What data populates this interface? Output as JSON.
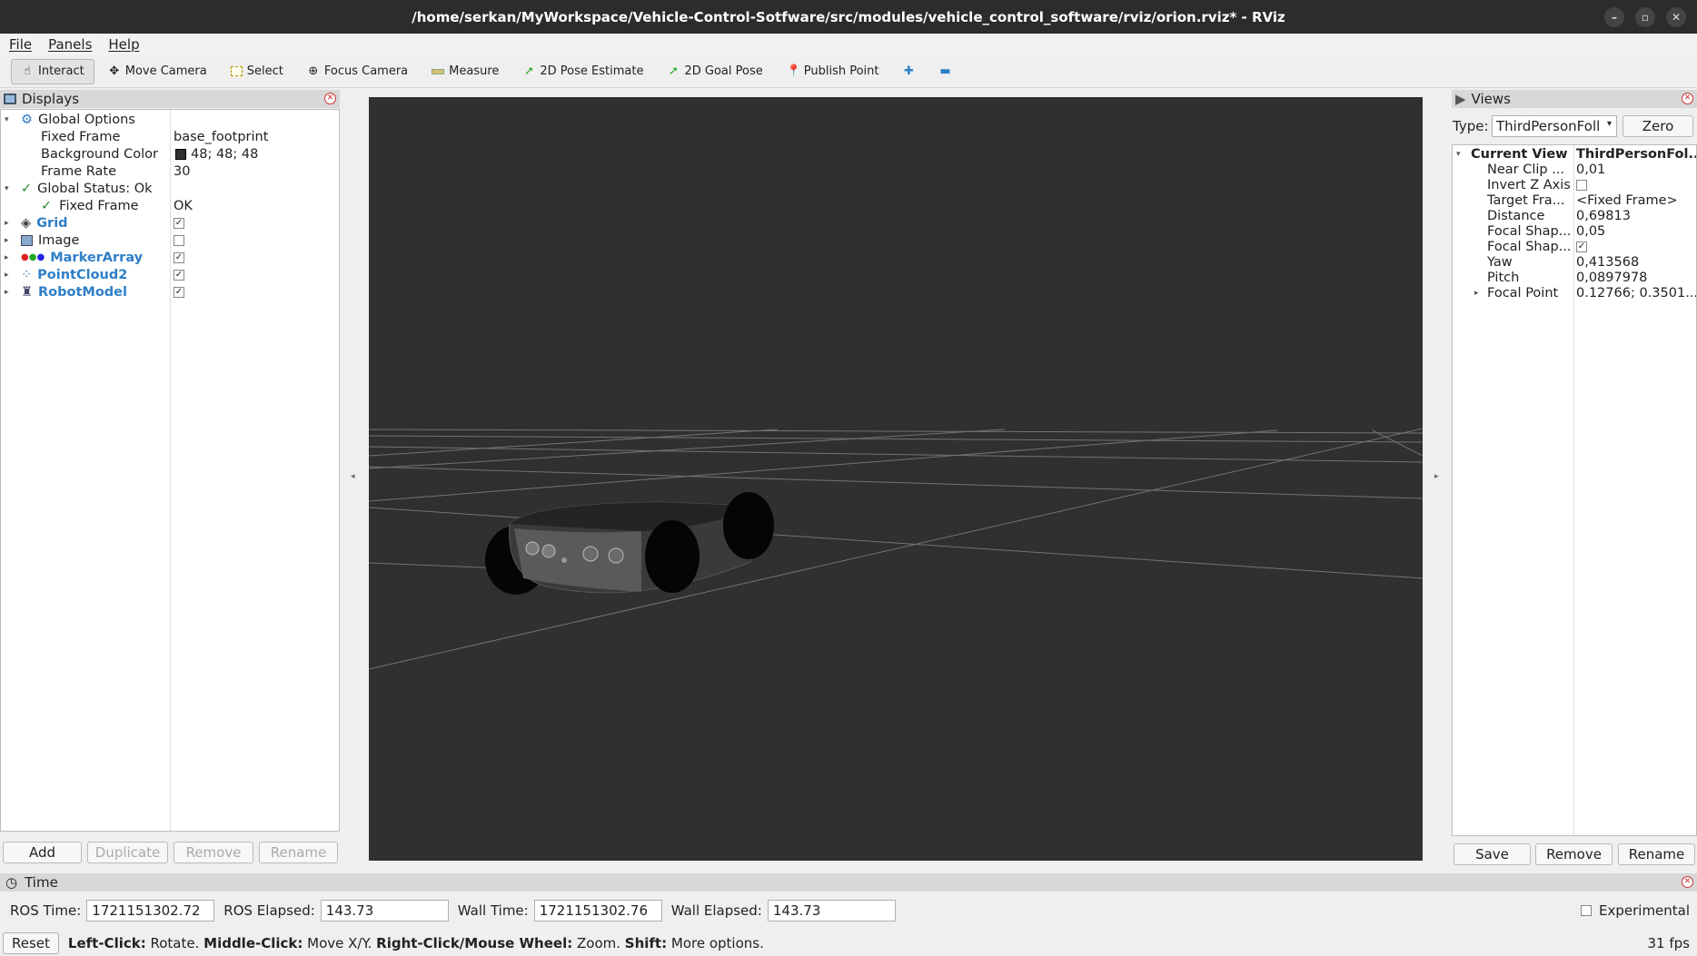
{
  "window": {
    "title": "/home/serkan/MyWorkspace/Vehicle-Control-Sotfware/src/modules/vehicle_control_software/rviz/orion.rviz* - RViz"
  },
  "menu": {
    "file": "File",
    "panels": "Panels",
    "help": "Help"
  },
  "toolbar": {
    "interact": "Interact",
    "move_camera": "Move Camera",
    "select": "Select",
    "focus_camera": "Focus Camera",
    "measure": "Measure",
    "pose_estimate": "2D Pose Estimate",
    "goal_pose": "2D Goal Pose",
    "publish_point": "Publish Point"
  },
  "displays": {
    "title": "Displays",
    "global_options": "Global Options",
    "fixed_frame_label": "Fixed Frame",
    "fixed_frame_value": "base_footprint",
    "bg_color_label": "Background Color",
    "bg_color_value": "48; 48; 48",
    "frame_rate_label": "Frame Rate",
    "frame_rate_value": "30",
    "global_status": "Global Status: Ok",
    "status_fixed_frame_label": "Fixed Frame",
    "status_fixed_frame_value": "OK",
    "items": [
      {
        "label": "Grid",
        "checked": true
      },
      {
        "label": "Image",
        "checked": false
      },
      {
        "label": "MarkerArray",
        "checked": true
      },
      {
        "label": "PointCloud2",
        "checked": true
      },
      {
        "label": "RobotModel",
        "checked": true
      }
    ],
    "buttons": {
      "add": "Add",
      "duplicate": "Duplicate",
      "remove": "Remove",
      "rename": "Rename"
    }
  },
  "views": {
    "title": "Views",
    "type_label": "Type:",
    "type_value": "ThirdPersonFoll",
    "zero": "Zero",
    "current_view": "Current View",
    "current_view_value": "ThirdPersonFol...",
    "props": [
      {
        "label": "Near Clip ...",
        "value": "0,01"
      },
      {
        "label": "Invert Z Axis",
        "value": ""
      },
      {
        "label": "Target Fra...",
        "value": "<Fixed Frame>"
      },
      {
        "label": "Distance",
        "value": "0,69813"
      },
      {
        "label": "Focal Shap...",
        "value": "0,05"
      },
      {
        "label": "Focal Shap...",
        "value": ""
      },
      {
        "label": "Yaw",
        "value": "0,413568"
      },
      {
        "label": "Pitch",
        "value": "0,0897978"
      },
      {
        "label": "Focal Point",
        "value": "0.12766; 0.3501..."
      }
    ],
    "buttons": {
      "save": "Save",
      "remove": "Remove",
      "rename": "Rename"
    }
  },
  "time": {
    "title": "Time",
    "ros_time_label": "ROS Time:",
    "ros_time": "1721151302.72",
    "ros_elapsed_label": "ROS Elapsed:",
    "ros_elapsed": "143.73",
    "wall_time_label": "Wall Time:",
    "wall_time": "1721151302.76",
    "wall_elapsed_label": "Wall Elapsed:",
    "wall_elapsed": "143.73",
    "experimental": "Experimental"
  },
  "status": {
    "reset": "Reset",
    "h1": "Left-Click:",
    "t1": " Rotate. ",
    "h2": "Middle-Click:",
    "t2": " Move X/Y. ",
    "h3": "Right-Click/Mouse Wheel:",
    "t3": " Zoom. ",
    "h4": "Shift:",
    "t4": " More options.",
    "fps": "31 fps"
  }
}
